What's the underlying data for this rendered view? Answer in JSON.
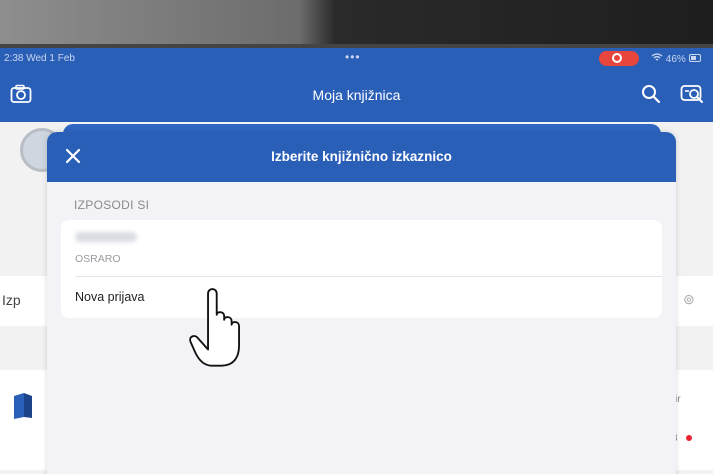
{
  "status_bar": {
    "time": "2:38  Wed 1 Feb",
    "dots": "•••",
    "battery": "46%"
  },
  "navbar": {
    "title": "Moja knjižnica",
    "icons": [
      "camera-icon",
      "search-icon",
      "scan-card-icon"
    ]
  },
  "background": {
    "section_label": "Izp"
  },
  "sheet": {
    "title": "Izberite knjižnično izkaznico",
    "section_label": "IZPOSODI SI",
    "library_code": "OSRARO",
    "new_login_label": "Nova prijava"
  },
  "colors": {
    "brand_blue": "#2a5fb8",
    "record_red": "#e8453c"
  }
}
